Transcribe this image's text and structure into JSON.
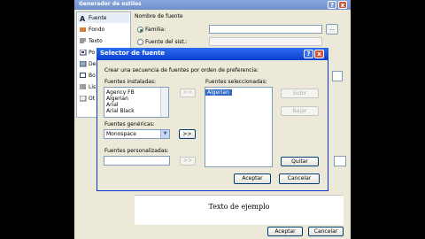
{
  "outer": {
    "title": "Generador de estilos",
    "help_icon": "?",
    "close_icon": "x",
    "nav": [
      {
        "label": "Fuente",
        "icon": "font-icon",
        "selected": true
      },
      {
        "label": "Fondo",
        "icon": "background-icon"
      },
      {
        "label": "Texto",
        "icon": "text-icon"
      },
      {
        "label": "Po",
        "icon": "position-icon"
      },
      {
        "label": "De",
        "icon": "layout-icon"
      },
      {
        "label": "Bo",
        "icon": "edges-icon"
      },
      {
        "label": "Lis",
        "icon": "lists-icon"
      },
      {
        "label": "Ot",
        "icon": "other-icon"
      }
    ],
    "font_name_label": "Nombre de fuente",
    "family_label": "Familia:",
    "system_label": "Fuente del sist.:",
    "browse_label": "...",
    "preview_text": "Texto de ejemplo",
    "ok_label": "Aceptar",
    "cancel_label": "Cancelar"
  },
  "inner": {
    "title": "Selector de fuente",
    "help_icon": "?",
    "close_icon": "x",
    "instructions": "Crear una secuencia de fuentes por orden de preferencia:",
    "installed_label": "Fuentes instaladas:",
    "installed_fonts": [
      "Agency FB",
      "Algerian",
      "Arial",
      "Arial Black"
    ],
    "selected_label": "Fuentes seleccionadas:",
    "selected_fonts": [
      "Algerian"
    ],
    "add_installed_label": ">>",
    "generic_label": "Fuentes genéricas:",
    "generic_value": "Monospace",
    "add_generic_label": ">>",
    "custom_label": "Fuentes personalizadas:",
    "custom_value": "",
    "add_custom_label": ">>",
    "up_label": "Subir",
    "down_label": "Bajar",
    "remove_label": "Quitar",
    "ok_label": "Aceptar",
    "cancel_label": "Cancelar"
  }
}
